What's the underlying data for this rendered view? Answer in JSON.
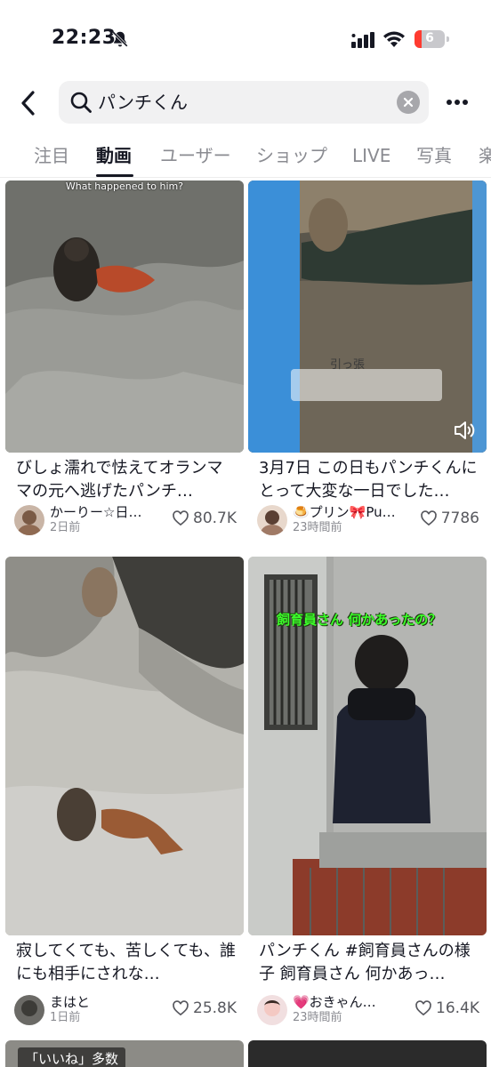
{
  "status_bar": {
    "time": "22:23",
    "battery": "6",
    "icons": [
      "bell-off-icon",
      "signal-icon",
      "wifi-icon",
      "battery-icon"
    ]
  },
  "search": {
    "query": "パンチくん",
    "icons": [
      "back-icon",
      "search-icon",
      "clear-icon",
      "more-icon"
    ]
  },
  "tabs": [
    {
      "label": "注目"
    },
    {
      "label": "動画"
    },
    {
      "label": "ユーザー"
    },
    {
      "label": "ショップ"
    },
    {
      "label": "LIVE"
    },
    {
      "label": "写真"
    },
    {
      "label": "楽"
    }
  ],
  "active_tab": "動画",
  "cards": [
    {
      "overlay_text": "What happened to him?",
      "title": "びしょ濡れで怯えてオランママの元へ逃げたパンチ…",
      "author": "かーりー☆日…",
      "date": "2日前",
      "likes": "80.7K"
    },
    {
      "overlay_text": "引っ張",
      "title": "3月7日 この日もパンチくんにとって大変な一日でした…",
      "author": "🍮プリン🎀Pu…",
      "date": "23時間前",
      "likes": "7786"
    },
    {
      "title": "寂してくても、苦しくても、誰にも相手にされな…",
      "author": "まはと",
      "date": "1日前",
      "likes": "25.8K"
    },
    {
      "overlay_text": "飼育員さん 何かあったの？",
      "title": "パンチくん #飼育員さんの様子 飼育員さん 何かあっ…",
      "author": "💗おきゃん…",
      "date": "23時間前",
      "likes": "16.4K"
    },
    {
      "overlay_text": "「いいね」多数"
    }
  ],
  "colors": {
    "text": "#161823",
    "muted": "#8a8b91",
    "search_bg": "#f1f1f2",
    "battery_low": "#ff3b30",
    "caption_green": "#3cff2a"
  }
}
